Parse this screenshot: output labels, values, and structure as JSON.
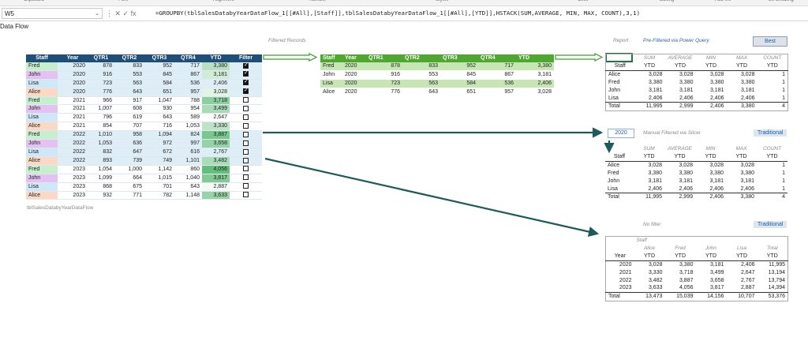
{
  "ribbon": [
    "Clipboard",
    "Font",
    "Alignment",
    "Number",
    "Styles",
    "Cells",
    "Editing",
    "Add-ins",
    "Be amazing"
  ],
  "namebox": "W5",
  "formula_buttons": "⋮  ✕  ✓  fx",
  "formula": "=GROUPBY(tblSalesDatabyYearDataFlow_1[[#All],[Staff]],tblSalesDatabyYearDataFlow_1[[#All],[YTD]],HSTACK(SUM,AVERAGE, MIN, MAX, COUNT),3,1)",
  "sheet_title": "Data Flow",
  "source": {
    "table_name": "tblSalesDatabyYearDataFlow",
    "headers": [
      "Staff",
      "Year",
      "QTR1",
      "QTR2",
      "QTR3",
      "QTR4",
      "YTD",
      "Filter"
    ],
    "rows": [
      [
        "Fred",
        "2020",
        "878",
        "833",
        "952",
        "717",
        "3,380",
        true
      ],
      [
        "John",
        "2020",
        "916",
        "553",
        "845",
        "867",
        "3,181",
        true
      ],
      [
        "Lisa",
        "2020",
        "723",
        "563",
        "584",
        "536",
        "2,406",
        true
      ],
      [
        "Alice",
        "2020",
        "776",
        "643",
        "651",
        "957",
        "3,028",
        true
      ],
      [
        "Fred",
        "2021",
        "966",
        "917",
        "1,047",
        "788",
        "3,718",
        false
      ],
      [
        "John",
        "2021",
        "1,007",
        "608",
        "930",
        "954",
        "3,499",
        false
      ],
      [
        "Lisa",
        "2021",
        "796",
        "619",
        "643",
        "589",
        "2,647",
        false
      ],
      [
        "Alice",
        "2021",
        "854",
        "707",
        "716",
        "1,053",
        "3,330",
        false
      ],
      [
        "Fred",
        "2022",
        "1,010",
        "958",
        "1,094",
        "824",
        "3,887",
        false
      ],
      [
        "John",
        "2022",
        "1,053",
        "636",
        "972",
        "997",
        "3,658",
        false
      ],
      [
        "Lisa",
        "2022",
        "832",
        "647",
        "672",
        "616",
        "2,767",
        false
      ],
      [
        "Alice",
        "2022",
        "893",
        "739",
        "749",
        "1,101",
        "3,482",
        false
      ],
      [
        "Fred",
        "2023",
        "1,054",
        "1,000",
        "1,142",
        "860",
        "4,056",
        false
      ],
      [
        "John",
        "2023",
        "1,099",
        "664",
        "1,015",
        "1,040",
        "3,817",
        false
      ],
      [
        "Lisa",
        "2023",
        "868",
        "675",
        "701",
        "643",
        "2,887",
        false
      ],
      [
        "Alice",
        "2023",
        "932",
        "771",
        "782",
        "1,148",
        "3,633",
        false
      ]
    ]
  },
  "filtered": {
    "label": "Filtered Records",
    "headers": [
      "Staff",
      "Year",
      "QTR1",
      "QTR2",
      "QTR3",
      "QTR4",
      "YTD"
    ],
    "rows": [
      [
        "Fred",
        "2020",
        "878",
        "833",
        "952",
        "717",
        "3,380"
      ],
      [
        "John",
        "2020",
        "916",
        "553",
        "845",
        "867",
        "3,181"
      ],
      [
        "Lisa",
        "2020",
        "723",
        "563",
        "584",
        "536",
        "2,406"
      ],
      [
        "Alice",
        "2020",
        "776",
        "643",
        "651",
        "957",
        "3,028"
      ]
    ]
  },
  "report1": {
    "label": "Report",
    "sublabel": "Pre-Filtered via Power Query",
    "button": "Best",
    "hd1": [
      "",
      "SUM",
      "AVERAGE",
      "MIN",
      "MAX",
      "COUNT"
    ],
    "hd2": [
      "Staff",
      "YTD",
      "YTD",
      "YTD",
      "YTD",
      "YTD"
    ],
    "rows": [
      [
        "Alice",
        "3,028",
        "3,028",
        "3,028",
        "3,028",
        "1"
      ],
      [
        "Fred",
        "3,380",
        "3,380",
        "3,380",
        "3,380",
        "1"
      ],
      [
        "John",
        "3,181",
        "3,181",
        "3,181",
        "3,181",
        "1"
      ],
      [
        "Lisa",
        "2,406",
        "2,406",
        "2,406",
        "2,406",
        "1"
      ]
    ],
    "total": [
      "Total",
      "11,995",
      "2,999",
      "2,406",
      "3,380",
      "4"
    ]
  },
  "report2": {
    "year": "2020",
    "sublabel": "Manual Filtered via Slicer",
    "tag": "Traditional",
    "hd1": [
      "",
      "SUM",
      "AVERAGE",
      "MIN",
      "MAX",
      "COUNT"
    ],
    "hd2": [
      "Staff",
      "YTD",
      "YTD",
      "YTD",
      "YTD",
      "YTD"
    ],
    "rows": [
      [
        "Alice",
        "3,028",
        "3,028",
        "3,028",
        "3,028",
        "1"
      ],
      [
        "Fred",
        "3,380",
        "3,380",
        "3,380",
        "3,380",
        "1"
      ],
      [
        "John",
        "3,181",
        "3,181",
        "3,181",
        "3,181",
        "1"
      ],
      [
        "Lisa",
        "2,406",
        "2,406",
        "2,406",
        "2,406",
        "1"
      ]
    ],
    "total": [
      "Total",
      "11,995",
      "2,999",
      "2,406",
      "3,380",
      "4"
    ]
  },
  "report3": {
    "sublabel": "No filter",
    "tag": "Traditional",
    "staff_label": "Staff",
    "cols": [
      "Alice",
      "Fred",
      "John",
      "Lisa",
      "Total"
    ],
    "hd2": [
      "Year",
      "YTD",
      "YTD",
      "YTD",
      "YTD",
      "YTD"
    ],
    "rows": [
      [
        "2020",
        "3,028",
        "3,380",
        "3,181",
        "2,406",
        "11,995"
      ],
      [
        "2021",
        "3,330",
        "3,718",
        "3,499",
        "2,647",
        "13,194"
      ],
      [
        "2022",
        "3,482",
        "3,887",
        "3,658",
        "2,767",
        "13,794"
      ],
      [
        "2023",
        "3,633",
        "4,056",
        "3,817",
        "2,887",
        "14,394"
      ]
    ],
    "total": [
      "Total",
      "13,473",
      "15,039",
      "14,156",
      "10,707",
      "53,376"
    ]
  },
  "colors": {
    "source_header": "#1f4e79",
    "filtered_header": "#4ea72e",
    "arrow": "#1d5a5a",
    "ytd_high": "#63be7b",
    "staff_fred": "#c6efce",
    "staff_john": "#e4c1f0",
    "staff_lisa": "#cfe8f7",
    "staff_alice": "#fbd9c4"
  }
}
